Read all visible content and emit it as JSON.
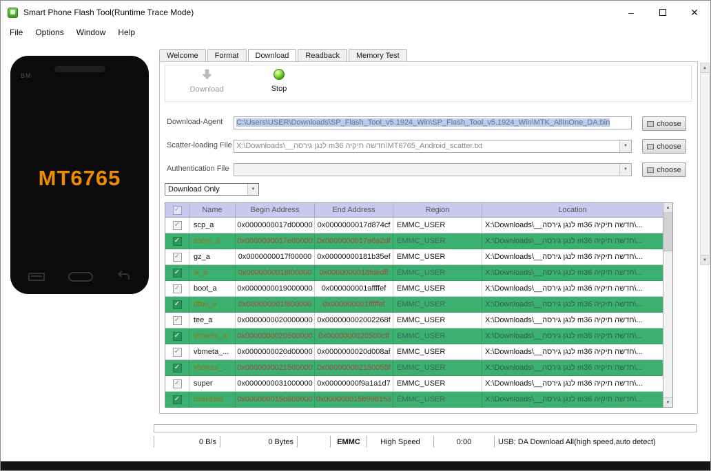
{
  "window": {
    "title": "Smart Phone Flash Tool(Runtime Trace Mode)",
    "minimize_glyph": "–",
    "close_glyph": "✕"
  },
  "menu": {
    "items": [
      {
        "label": "File"
      },
      {
        "label": "Options"
      },
      {
        "label": "Window"
      },
      {
        "label": "Help"
      }
    ]
  },
  "phone": {
    "brand": "BM",
    "chip": "MT6765"
  },
  "tabs": {
    "items": [
      {
        "label": "Welcome"
      },
      {
        "label": "Format"
      },
      {
        "label": "Download",
        "active": true
      },
      {
        "label": "Readback"
      },
      {
        "label": "Memory Test"
      }
    ]
  },
  "toolbar": {
    "download_label": "Download",
    "stop_label": "Stop"
  },
  "form": {
    "download_agent": {
      "label": "Download-Agent",
      "value": "C:\\Users\\USER\\Downloads\\SP_Flash_Tool_v5.1924_Win\\SP_Flash_Tool_v5.1924_Win\\MTK_AllInOne_DA.bin",
      "button": "choose"
    },
    "scatter_file": {
      "label": "Scatter-loading File",
      "value": "X:\\Downloads\\__לנגן גירסה m36 חדשה תיקיה\\MT6765_Android_scatter.txt",
      "button": "choose"
    },
    "auth_file": {
      "label": "Authentication File",
      "value": "",
      "button": "choose"
    },
    "mode": {
      "value": "Download Only"
    }
  },
  "table": {
    "headers": {
      "name": "Name",
      "begin": "Begin Address",
      "end": "End Address",
      "region": "Region",
      "location": "Location"
    },
    "rows": [
      {
        "name": "scp_a",
        "begin": "0x0000000017d00000",
        "end": "0x0000000017d874cf",
        "region": "EMMC_USER",
        "location": "X:\\Downloads\\__לנגן גירסה m36 חדשה תיקיה\\...",
        "checked": true,
        "green": false
      },
      {
        "name": "sspm_a",
        "begin": "0x0000000017e00000",
        "end": "0x0000000017e6a2df",
        "region": "EMMC_USER",
        "location": "X:\\Downloads\\__לנגן גירסה m36 חדשה תיקיה\\...",
        "checked": true,
        "green": true
      },
      {
        "name": "gz_a",
        "begin": "0x0000000017f00000",
        "end": "0x00000000181b35ef",
        "region": "EMMC_USER",
        "location": "X:\\Downloads\\__לנגן גירסה m36 חדשה תיקיה\\...",
        "checked": true,
        "green": false
      },
      {
        "name": "lk_a",
        "begin": "0x0000000018f00000",
        "end": "0x0000000018fdedff",
        "region": "EMMC_USER",
        "location": "X:\\Downloads\\__לנגן גירסה m36 חדשה תיקיה\\...",
        "checked": true,
        "green": true
      },
      {
        "name": "boot_a",
        "begin": "0x0000000019000000",
        "end": "0x000000001affffef",
        "region": "EMMC_USER",
        "location": "X:\\Downloads\\__לנגן גירסה m36 חדשה תיקיה\\...",
        "checked": true,
        "green": false
      },
      {
        "name": "dtbo_a",
        "begin": "0x000000001f800000",
        "end": "0x000000001fffffef",
        "region": "EMMC_USER",
        "location": "X:\\Downloads\\__לנגן גירסה m36 חדשה תיקיה\\...",
        "checked": true,
        "green": true
      },
      {
        "name": "tee_a",
        "begin": "0x0000000020000000",
        "end": "0x000000002002268f",
        "region": "EMMC_USER",
        "location": "X:\\Downloads\\__לנגן גירסה m36 חדשה תיקיה\\...",
        "checked": true,
        "green": false
      },
      {
        "name": "vbmeta_a",
        "begin": "0x0000000020500000",
        "end": "0x0000000020500cff",
        "region": "EMMC_USER",
        "location": "X:\\Downloads\\__לנגן גירסה m36 חדשה תיקיה\\...",
        "checked": true,
        "green": true
      },
      {
        "name": "vbmeta_...",
        "begin": "0x0000000020d00000",
        "end": "0x0000000020d008af",
        "region": "EMMC_USER",
        "location": "X:\\Downloads\\__לנגן גירסה m36 חדשה תיקיה\\...",
        "checked": true,
        "green": false
      },
      {
        "name": "vbmeta_...",
        "begin": "0x0000000021500000",
        "end": "0x000000002150058f",
        "region": "EMMC_USER",
        "location": "X:\\Downloads\\__לנגן גירסה m36 חדשה תיקיה\\...",
        "checked": true,
        "green": true
      },
      {
        "name": "super",
        "begin": "0x0000000031000000",
        "end": "0x00000000f9a1a1d7",
        "region": "EMMC_USER",
        "location": "X:\\Downloads\\__לנגן גירסה m36 חדשה תיקיה\\...",
        "checked": true,
        "green": false
      },
      {
        "name": "userdata",
        "begin": "0x000000015b800000",
        "end": "0x000000015b998153",
        "region": "EMMC_USER",
        "location": "X:\\Downloads\\__לנגן גירסה m36 חדשה תיקיה\\...",
        "checked": true,
        "green": true
      }
    ]
  },
  "statusbar": {
    "speed": "0 B/s",
    "bytes": "0 Bytes",
    "spare": "",
    "storage": "EMMC",
    "link_speed": "High Speed",
    "elapsed": "0:00",
    "usb": "USB: DA Download All(high speed,auto detect)"
  },
  "icons": {
    "check": "✓",
    "caret": "▼",
    "arrow_up": "▲",
    "arrow_down": "▼"
  },
  "colors": {
    "selected_row_green": "#3bb070",
    "chip_orange": "#ef8b00",
    "table_header": "#c9c9ef",
    "path_highlight": "#b9cdf0"
  }
}
